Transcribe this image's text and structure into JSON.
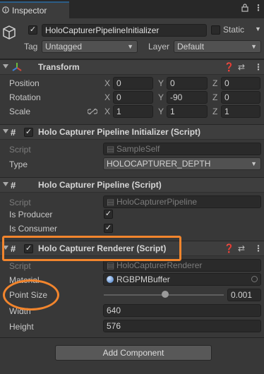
{
  "tab": {
    "label": "Inspector",
    "lock_icon": "lock-icon",
    "menu_icon": "kebab-menu-icon"
  },
  "header": {
    "object_name": "HoloCapturerPipelineInitializer",
    "active": true,
    "static_label": "Static",
    "tag_label": "Tag",
    "tag_value": "Untagged",
    "layer_label": "Layer",
    "layer_value": "Default"
  },
  "transform": {
    "title": "Transform",
    "rows": [
      {
        "label": "Position",
        "x": "0",
        "y": "0",
        "z": "0"
      },
      {
        "label": "Rotation",
        "x": "0",
        "y": "-90",
        "z": "0"
      },
      {
        "label": "Scale",
        "x": "1",
        "y": "1",
        "z": "1"
      }
    ],
    "axis": {
      "x": "X",
      "y": "Y",
      "z": "Z"
    }
  },
  "comp_initializer": {
    "title": "Holo Capturer Pipeline Initializer (Script)",
    "enabled": true,
    "script_label": "Script",
    "script_value": "SampleSelf",
    "type_label": "Type",
    "type_value": "HOLOCAPTURER_DEPTH"
  },
  "comp_pipeline": {
    "title": "Holo Capturer Pipeline (Script)",
    "script_label": "Script",
    "script_value": "HoloCapturerPipeline",
    "producer_label": "Is Producer",
    "producer_checked": true,
    "consumer_label": "Is Consumer",
    "consumer_checked": true
  },
  "comp_renderer": {
    "title": "Holo Capturer Renderer (Script)",
    "enabled": true,
    "script_label": "Script",
    "script_value": "HoloCapturerRenderer",
    "material_label": "Material",
    "material_value": "RGBPMBuffer",
    "point_size_label": "Point Size",
    "point_size_value": "0.001",
    "point_size_slider_fraction": 0.51,
    "width_label": "Width",
    "width_value": "640",
    "height_label": "Height",
    "height_value": "576"
  },
  "add_component_label": "Add Component",
  "annotation_color": "#f2852d"
}
